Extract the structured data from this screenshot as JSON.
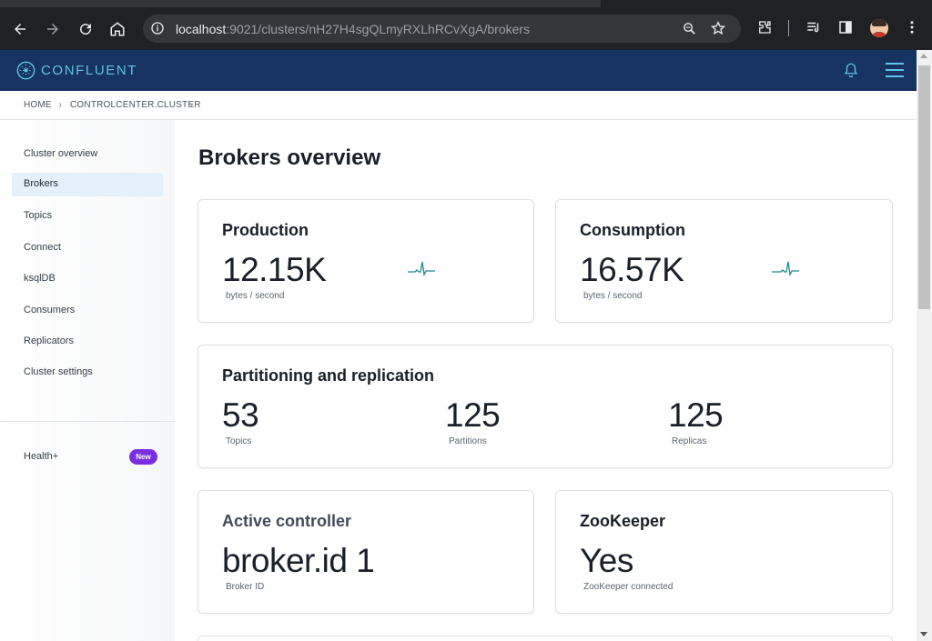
{
  "browser": {
    "url_host": "localhost",
    "url_rest": ":9021/clusters/nH27H4sgQLmyRXLhRCvXgA/brokers"
  },
  "app": {
    "brand": "CONFLUENT"
  },
  "breadcrumb": {
    "items": [
      "HOME",
      "CONTROLCENTER.CLUSTER"
    ],
    "separator": "›"
  },
  "sidebar": {
    "items": [
      {
        "label": "Cluster overview",
        "active": false
      },
      {
        "label": "Brokers",
        "active": true
      },
      {
        "label": "Topics",
        "active": false
      },
      {
        "label": "Connect",
        "active": false
      },
      {
        "label": "ksqlDB",
        "active": false
      },
      {
        "label": "Consumers",
        "active": false
      },
      {
        "label": "Replicators",
        "active": false
      },
      {
        "label": "Cluster settings",
        "active": false
      }
    ],
    "health": {
      "label": "Health+",
      "badge": "New"
    }
  },
  "main": {
    "title": "Brokers overview",
    "production": {
      "title": "Production",
      "value": "12.15K",
      "unit": "bytes / second"
    },
    "consumption": {
      "title": "Consumption",
      "value": "16.57K",
      "unit": "bytes / second"
    },
    "partitioning": {
      "title": "Partitioning and replication",
      "stats": [
        {
          "value": "53",
          "label": "Topics"
        },
        {
          "value": "125",
          "label": "Partitions"
        },
        {
          "value": "125",
          "label": "Replicas"
        }
      ]
    },
    "controller": {
      "title": "Active controller",
      "value": "broker.id 1",
      "unit": "Broker ID"
    },
    "zookeeper": {
      "title": "ZooKeeper",
      "value": "Yes",
      "unit": "ZooKeeper connected"
    }
  },
  "colors": {
    "header_bg": "#173361",
    "brand_accent": "#5ec4e8",
    "active_item_bg": "#e4f1fa",
    "badge_purple": "#7b2fe3",
    "sparkline": "#1a8a8f"
  }
}
